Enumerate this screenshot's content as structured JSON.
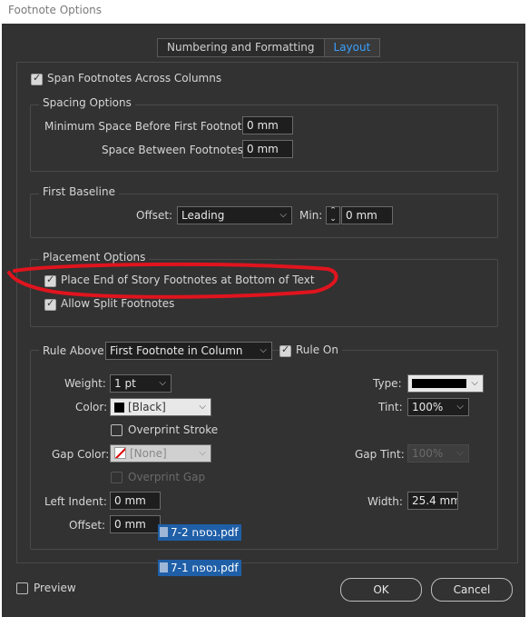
{
  "window": {
    "title": "Footnote Options"
  },
  "tabs": [
    {
      "label": "Numbering and Formatting"
    },
    {
      "label": "Layout"
    }
  ],
  "layout": {
    "span_footnotes": {
      "label": "Span Footnotes Across Columns",
      "checked": true
    },
    "spacing": {
      "title": "Spacing Options",
      "min_space_label": "Minimum Space Before First Footnote:",
      "min_space_value": "0 mm",
      "between_label": "Space Between Footnotes:",
      "between_value": "0 mm"
    },
    "first_baseline": {
      "title": "First Baseline",
      "offset_label": "Offset:",
      "offset_value": "Leading",
      "min_label": "Min:",
      "min_value": "0 mm"
    },
    "placement": {
      "title": "Placement Options",
      "end_of_story": {
        "label": "Place End of Story Footnotes at Bottom of Text",
        "checked": true
      },
      "allow_split": {
        "label": "Allow Split Footnotes",
        "checked": true
      }
    },
    "rule": {
      "rule_above_label": "Rule Above:",
      "rule_above_value": "First Footnote in Column",
      "rule_on_label": "Rule On",
      "weight_label": "Weight:",
      "weight_value": "1 pt",
      "type_label": "Type:",
      "color_label": "Color:",
      "color_value": "[Black]",
      "tint_label": "Tint:",
      "tint_value": "100%",
      "overprint_stroke_label": "Overprint Stroke",
      "gap_color_label": "Gap Color:",
      "gap_color_value": "[None]",
      "gap_tint_label": "Gap Tint:",
      "gap_tint_value": "100%",
      "overprint_gap_label": "Overprint Gap",
      "left_indent_label": "Left Indent:",
      "left_indent_value": "0 mm",
      "width_label": "Width:",
      "width_value": "25.4 mm",
      "offset_label": "Offset:",
      "offset_value": "0 mm"
    }
  },
  "footer": {
    "preview_label": "Preview",
    "ok_label": "OK",
    "cancel_label": "Cancel"
  },
  "drag_files": [
    {
      "name": "7-2 נספח.pdf"
    },
    {
      "name": "7-1 נספח.pdf"
    }
  ],
  "colors": {
    "accent": "#3aa0ff",
    "dialog_bg": "#323232",
    "annotation": "#e0141e",
    "file_highlight": "#1f5fa8"
  }
}
